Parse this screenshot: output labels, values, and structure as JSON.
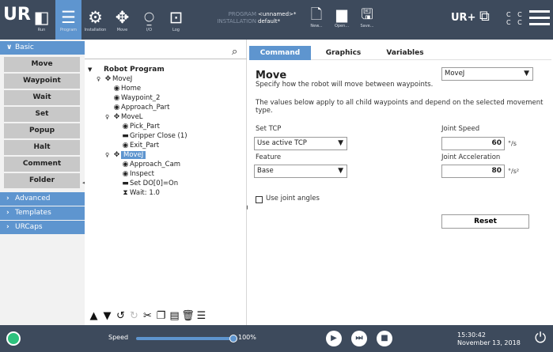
{
  "header": {
    "logo_text": "UR",
    "nav": [
      {
        "label": "Run",
        "icon": "run-icon"
      },
      {
        "label": "Program",
        "icon": "program-icon"
      },
      {
        "label": "Installation",
        "icon": "installation-icon"
      },
      {
        "label": "Move",
        "icon": "move-icon"
      },
      {
        "label": "I/O",
        "icon": "io-icon"
      },
      {
        "label": "Log",
        "icon": "log-icon"
      }
    ],
    "program_key": "PROGRAM",
    "program_value": "<unnamed>*",
    "installation_key": "INSTALLATION",
    "installation_value": "default*",
    "file_buttons": [
      {
        "label": "New...",
        "icon": "new-file-icon"
      },
      {
        "label": "Open...",
        "icon": "open-folder-icon"
      },
      {
        "label": "Save...",
        "icon": "save-icon"
      }
    ],
    "urcaps_logo": "UR+",
    "cc_text": "C C\nC C"
  },
  "left_panel": {
    "categories": {
      "basic": "Basic",
      "advanced": "Advanced",
      "templates": "Templates",
      "urcaps": "URCaps"
    },
    "basic_items": [
      "Move",
      "Waypoint",
      "Wait",
      "Set",
      "Popup",
      "Halt",
      "Comment",
      "Folder"
    ]
  },
  "tree": {
    "search_placeholder": "",
    "nodes": [
      {
        "text": "Robot Program",
        "toggle": "▼",
        "icon": "",
        "depth": 0
      },
      {
        "text": "MoveJ",
        "toggle": "♀",
        "icon": "✥",
        "depth": 1
      },
      {
        "text": "Home",
        "toggle": "",
        "icon": "◉",
        "depth": 2
      },
      {
        "text": "Waypoint_2",
        "toggle": "",
        "icon": "◉",
        "depth": 2
      },
      {
        "text": "Approach_Part",
        "toggle": "",
        "icon": "◉",
        "depth": 2
      },
      {
        "text": "MoveL",
        "toggle": "♀",
        "icon": "✥",
        "depth": 2
      },
      {
        "text": "Pick_Part",
        "toggle": "",
        "icon": "◉",
        "depth": 3
      },
      {
        "text": "Gripper Close (1)",
        "toggle": "",
        "icon": "▬",
        "depth": 3
      },
      {
        "text": "Exit_Part",
        "toggle": "",
        "icon": "◉",
        "depth": 3
      },
      {
        "text": "MoveJ",
        "toggle": "♀",
        "icon": "✥",
        "depth": 2
      },
      {
        "text": "Approach_Cam",
        "toggle": "",
        "icon": "◉",
        "depth": 3
      },
      {
        "text": "Inspect",
        "toggle": "",
        "icon": "◉",
        "depth": 3
      },
      {
        "text": "Set DO[0]=On",
        "toggle": "",
        "icon": "▬",
        "depth": 3
      },
      {
        "text": "Wait: 1.0",
        "toggle": "",
        "icon": "⧗",
        "depth": 3
      }
    ],
    "selected_index": 9,
    "toolbar": [
      {
        "icon": "move-up-icon",
        "glyph": "▲",
        "disabled": false
      },
      {
        "icon": "move-down-icon",
        "glyph": "▼",
        "disabled": false
      },
      {
        "icon": "undo-icon",
        "glyph": "↺",
        "disabled": false
      },
      {
        "icon": "redo-icon",
        "glyph": "↻",
        "disabled": true
      },
      {
        "icon": "cut-icon",
        "glyph": "✂",
        "disabled": false
      },
      {
        "icon": "copy-icon",
        "glyph": "❐",
        "disabled": false
      },
      {
        "icon": "paste-icon",
        "glyph": "▤",
        "disabled": false
      },
      {
        "icon": "delete-icon",
        "glyph": "🗑",
        "disabled": false
      },
      {
        "icon": "suppress-icon",
        "glyph": "☰",
        "disabled": false
      }
    ]
  },
  "command": {
    "tabs": [
      "Command",
      "Graphics",
      "Variables"
    ],
    "active_tab": 0,
    "title": "Move",
    "move_type_value": "MoveJ",
    "description": "Specify how the robot will move between waypoints.",
    "note": "The values below apply to all child waypoints and depend on the selected movement type.",
    "set_tcp_label": "Set TCP",
    "tcp_value": "Use active TCP",
    "feature_label": "Feature",
    "feature_value": "Base",
    "joint_speed_label": "Joint Speed",
    "joint_speed_value": "60",
    "joint_speed_unit": "°/s",
    "joint_accel_label": "Joint Acceleration",
    "joint_accel_value": "80",
    "joint_accel_unit": "°/s²",
    "use_joint_angles_label": "Use joint angles",
    "reset_label": "Reset"
  },
  "footer": {
    "speed_label": "Speed",
    "speed_value": "100%",
    "speed_fraction": 1.0,
    "time": "15:30:42",
    "date": "November 13, 2018"
  }
}
